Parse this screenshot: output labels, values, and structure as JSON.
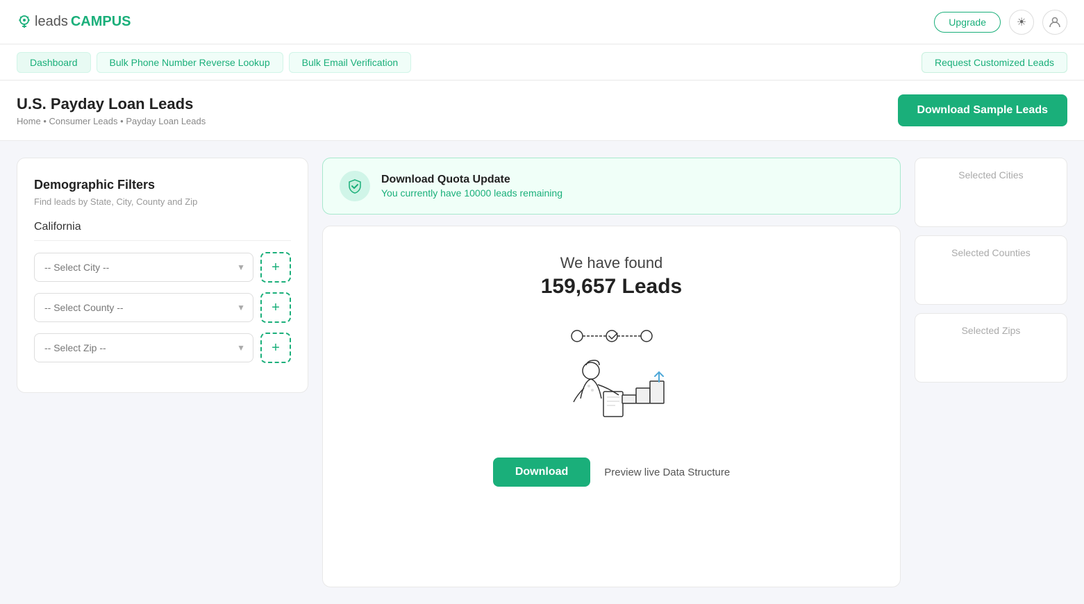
{
  "header": {
    "logo_leads": "leads",
    "logo_campus": "CAMPUS",
    "upgrade_label": "Upgrade",
    "theme_icon": "☀",
    "user_icon": "👤"
  },
  "nav": {
    "tabs": [
      {
        "label": "Dashboard",
        "active": true
      },
      {
        "label": "Bulk Phone Number Reverse Lookup",
        "active": false
      },
      {
        "label": "Bulk Email Verification",
        "active": false
      }
    ],
    "request_label": "Request Customized Leads"
  },
  "page_header": {
    "title": "U.S. Payday Loan Leads",
    "breadcrumb_home": "Home",
    "breadcrumb_sep1": "•",
    "breadcrumb_consumer": "Consumer Leads",
    "breadcrumb_sep2": "•",
    "breadcrumb_payday": "Payday Loan Leads",
    "download_sample_label": "Download Sample Leads"
  },
  "left_panel": {
    "title": "Demographic Filters",
    "subtitle": "Find leads by State, City, County and Zip",
    "state_label": "California",
    "city_placeholder": "-- Select City --",
    "county_placeholder": "-- Select County --",
    "zip_placeholder": "-- Select Zip --",
    "add_label": "+"
  },
  "quota_banner": {
    "title": "Download Quota Update",
    "subtitle": "You currently have 10000 leads remaining"
  },
  "results": {
    "found_text": "We have found",
    "count": "159,657 Leads"
  },
  "actions": {
    "download_label": "Download",
    "preview_label": "Preview live Data Structure"
  },
  "right_panel": {
    "selected_cities_label": "Selected Cities",
    "selected_counties_label": "Selected Counties",
    "selected_zips_label": "Selected Zips"
  }
}
